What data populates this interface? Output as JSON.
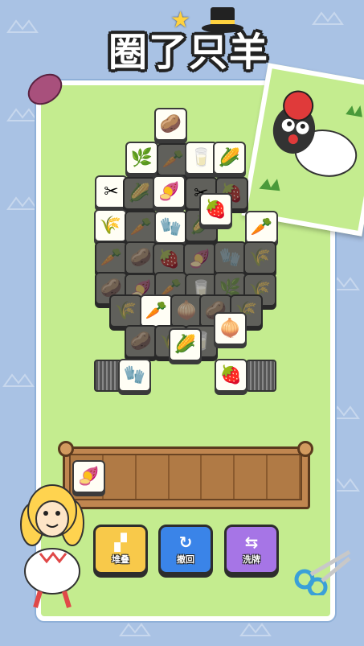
{
  "title": "圈了只羊",
  "tiles": [
    {
      "icon": "🥔",
      "name": "potato"
    },
    {
      "icon": "🌿",
      "name": "grass"
    },
    {
      "icon": "🥛",
      "name": "milk"
    },
    {
      "icon": "🌽",
      "name": "corn"
    },
    {
      "icon": "✂",
      "name": "scissors"
    },
    {
      "icon": "🍠",
      "name": "sweet-potato"
    },
    {
      "icon": "🍓",
      "name": "strawberry"
    },
    {
      "icon": "🌾",
      "name": "wheat"
    },
    {
      "icon": "🧤",
      "name": "glove"
    },
    {
      "icon": "🥕",
      "name": "carrot"
    },
    {
      "icon": "🧅",
      "name": "onion"
    }
  ],
  "tray": {
    "slots": 7,
    "filled": [
      {
        "icon": "🍠",
        "name": "sweet-potato"
      }
    ]
  },
  "buttons": [
    {
      "label": "堆叠",
      "icon": "▞",
      "color": "#f8c94a"
    },
    {
      "label": "撤回",
      "icon": "↻",
      "color": "#3a84e8"
    },
    {
      "label": "洗牌",
      "icon": "⇆",
      "color": "#a675e6"
    }
  ]
}
